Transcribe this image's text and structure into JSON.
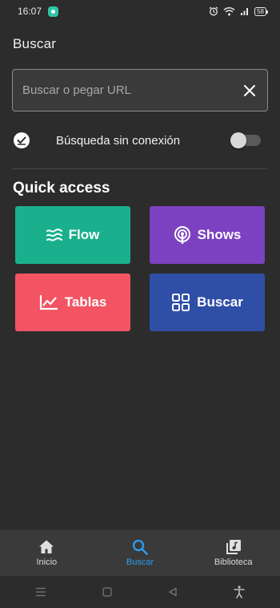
{
  "status_bar": {
    "time": "16:07",
    "battery": "58"
  },
  "header": {
    "title": "Buscar"
  },
  "search": {
    "placeholder": "Buscar o pegar URL",
    "value": ""
  },
  "offline": {
    "label": "Búsqueda sin conexión",
    "enabled": false
  },
  "quick_access": {
    "title": "Quick access",
    "tiles": [
      {
        "label": "Flow",
        "icon": "flow-icon",
        "color": "#1bb08d"
      },
      {
        "label": "Shows",
        "icon": "podcast-icon",
        "color": "#7c41c0"
      },
      {
        "label": "Tablas",
        "icon": "chart-icon",
        "color": "#f25463"
      },
      {
        "label": "Buscar",
        "icon": "grid-icon",
        "color": "#2f4fa6"
      }
    ]
  },
  "bottom_nav": {
    "items": [
      {
        "label": "Inicio",
        "icon": "home-icon",
        "active": false
      },
      {
        "label": "Buscar",
        "icon": "search-icon",
        "active": true
      },
      {
        "label": "Biblioteca",
        "icon": "library-icon",
        "active": false
      }
    ],
    "active_color": "#2d9cf0"
  }
}
